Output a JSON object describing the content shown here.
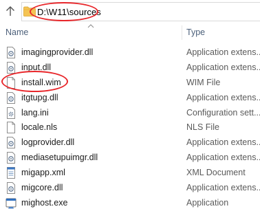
{
  "address": {
    "path": "D:\\W11\\sources"
  },
  "columns": {
    "name": "Name",
    "type": "Type"
  },
  "files": [
    {
      "name": "imagingprovider.dll",
      "type": "Application extens...",
      "icon": "dll-file-icon"
    },
    {
      "name": "input.dll",
      "type": "Application extens...",
      "icon": "dll-file-icon"
    },
    {
      "name": "install.wim",
      "type": "WIM File",
      "icon": "blank-file-icon"
    },
    {
      "name": "itgtupg.dll",
      "type": "Application extens...",
      "icon": "dll-file-icon"
    },
    {
      "name": "lang.ini",
      "type": "Configuration sett...",
      "icon": "ini-file-icon"
    },
    {
      "name": "locale.nls",
      "type": "NLS File",
      "icon": "blank-file-icon"
    },
    {
      "name": "logprovider.dll",
      "type": "Application extens...",
      "icon": "dll-file-icon"
    },
    {
      "name": "mediasetupuimgr.dll",
      "type": "Application extens...",
      "icon": "dll-file-icon"
    },
    {
      "name": "migapp.xml",
      "type": "XML Document",
      "icon": "xml-file-icon"
    },
    {
      "name": "migcore.dll",
      "type": "Application extens...",
      "icon": "dll-file-icon"
    },
    {
      "name": "mighost.exe",
      "type": "Application",
      "icon": "exe-file-icon"
    }
  ],
  "colors": {
    "highlight": "#e8262a",
    "header_text": "#4c607a",
    "folder": "#f5c454"
  }
}
